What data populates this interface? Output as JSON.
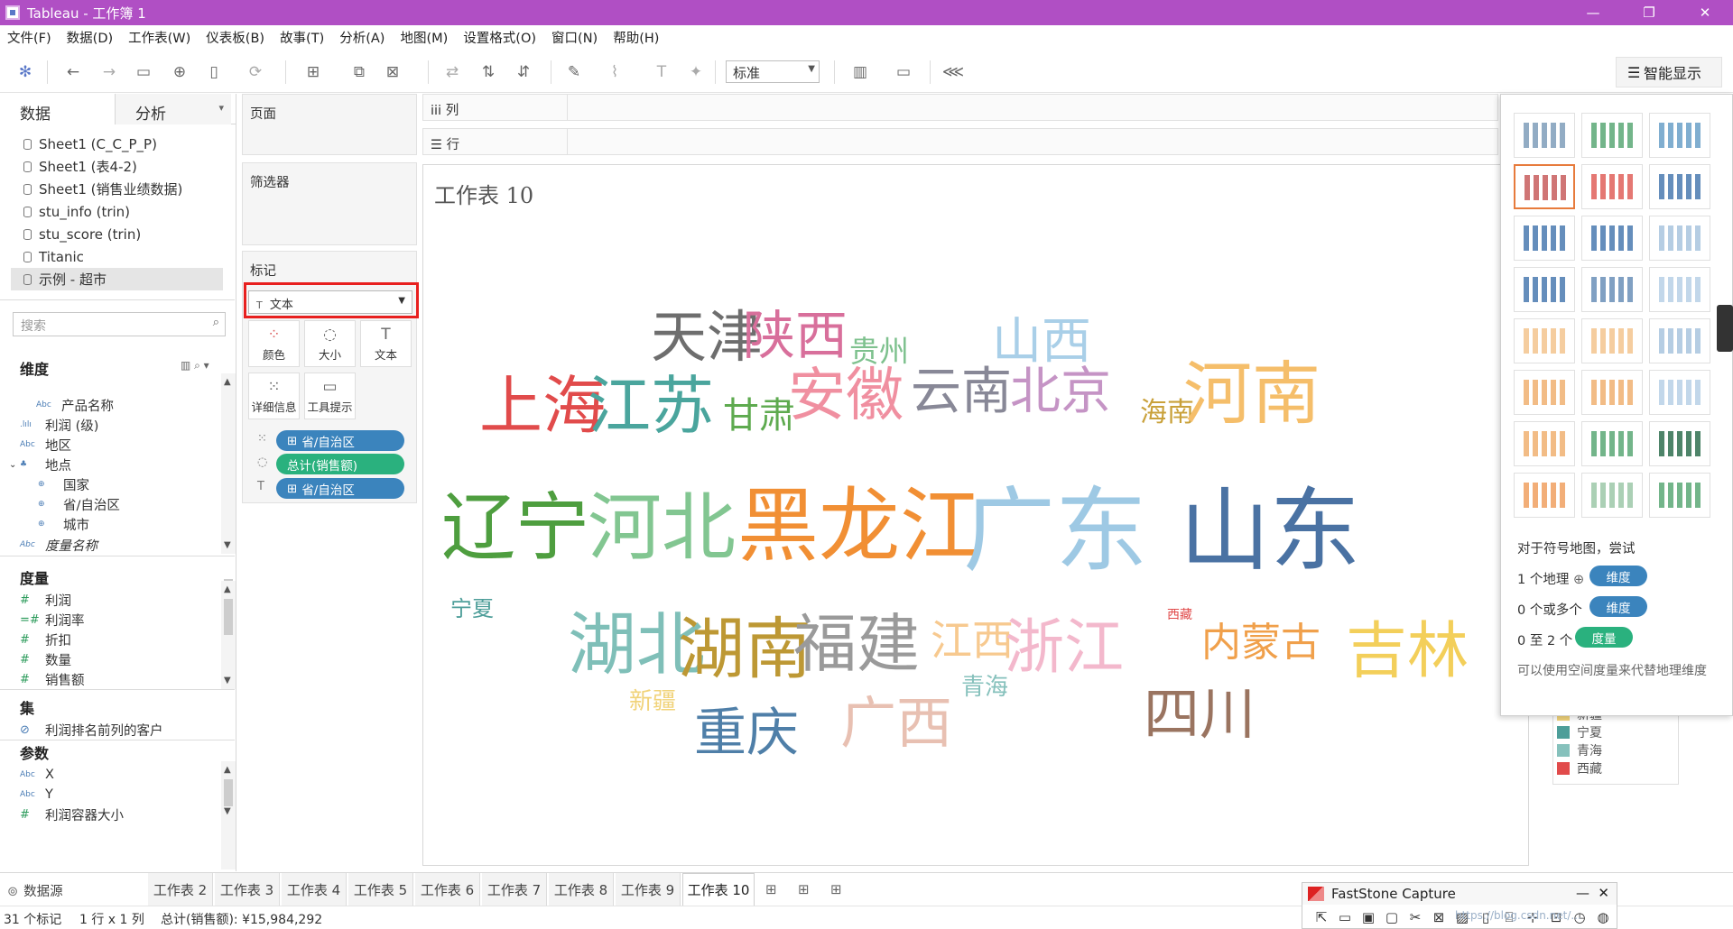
{
  "window": {
    "title": "Tableau - 工作簿 1",
    "controls": [
      "—",
      "❐",
      "✕"
    ]
  },
  "menu": [
    "文件(F)",
    "数据(D)",
    "工作表(W)",
    "仪表板(B)",
    "故事(T)",
    "分析(A)",
    "地图(M)",
    "设置格式(O)",
    "窗口(N)",
    "帮助(H)"
  ],
  "toolbar": {
    "fit_select": "标准",
    "show_me_label": "智能显示",
    "icons": [
      "tableau-logo-icon",
      "undo-icon",
      "redo-icon",
      "save-icon",
      "new-datasource-icon",
      "pause-updates-icon",
      "refresh-icon",
      "new-worksheet-icon",
      "duplicate-icon",
      "clear-sheet-icon",
      "swap-icon",
      "sort-asc-icon",
      "sort-desc-icon",
      "highlight-icon",
      "group-icon",
      "label-icon",
      "fix-axes-icon",
      "show-cards-icon",
      "presentation-icon",
      "share-icon"
    ]
  },
  "left_pane": {
    "tabs": [
      "数据",
      "分析"
    ],
    "datasources": [
      "Sheet1 (C_C_P_P)",
      "Sheet1 (表4-2)",
      "Sheet1 (销售业绩数据)",
      "stu_info (trin)",
      "stu_score (trin)",
      "Titanic",
      "示例 - 超市"
    ],
    "search_placeholder": "搜索",
    "dimensions_title": "维度",
    "dimensions": [
      {
        "type": "Abc",
        "name": "产品名称"
      },
      {
        "type": ".lılı",
        "name": "利润 (级)"
      },
      {
        "type": "Abc",
        "name": "地区"
      },
      {
        "type": "♣",
        "name": "地点"
      },
      {
        "type": "⊕",
        "name": "国家"
      },
      {
        "type": "⊕",
        "name": "省/自治区"
      },
      {
        "type": "⊕",
        "name": "城市"
      },
      {
        "type": "Abc",
        "name": "度量名称"
      }
    ],
    "measures_title": "度量",
    "measures": [
      "利润",
      "利润率",
      "折扣",
      "数量",
      "销售额"
    ],
    "sets_title": "集",
    "sets": [
      "利润排名前列的客户"
    ],
    "params_title": "参数",
    "params": [
      {
        "type": "Abc",
        "name": "X"
      },
      {
        "type": "Abc",
        "name": "Y"
      },
      {
        "type": "#",
        "name": "利润容器大小"
      }
    ]
  },
  "shelves": {
    "pages": "页面",
    "filters": "筛选器",
    "marks": "标记",
    "columns": "iii 列",
    "rows": "☰ 行"
  },
  "marks_card": {
    "mark_type": "文本",
    "buttons": [
      "颜色",
      "大小",
      "文本",
      "详细信息",
      "工具提示"
    ],
    "pills": [
      "省/自治区",
      "总计(销售额)",
      "省/自治区"
    ]
  },
  "view": {
    "sheet_title": "工作表 10",
    "words": [
      {
        "text": "天津",
        "color": "#6e6e6e"
      },
      {
        "text": "陕西",
        "color": "#d86f9b"
      },
      {
        "text": "贵州",
        "color": "#7ec18e"
      },
      {
        "text": "山西",
        "color": "#a9cfe8"
      },
      {
        "text": "上海",
        "color": "#e14b4b"
      },
      {
        "text": "江苏",
        "color": "#4aa59d"
      },
      {
        "text": "甘肃",
        "color": "#5eaa4f"
      },
      {
        "text": "安徽",
        "color": "#f08fa0"
      },
      {
        "text": "云南",
        "color": "#888897"
      },
      {
        "text": "北京",
        "color": "#c594c5"
      },
      {
        "text": "海南",
        "color": "#c9a13a"
      },
      {
        "text": "河南",
        "color": "#f5be6a"
      },
      {
        "text": "辽宁",
        "color": "#4e9e3f"
      },
      {
        "text": "河北",
        "color": "#82c691"
      },
      {
        "text": "黑龙江",
        "color": "#f18f34"
      },
      {
        "text": "广东",
        "color": "#9ec9e4"
      },
      {
        "text": "山东",
        "color": "#4a72a3"
      },
      {
        "text": "宁夏",
        "color": "#4d9e99"
      },
      {
        "text": "西藏",
        "color": "#e14b4b"
      },
      {
        "text": "湖北",
        "color": "#7fbfb8"
      },
      {
        "text": "湖南",
        "color": "#bd9834"
      },
      {
        "text": "福建",
        "color": "#9a9a9a"
      },
      {
        "text": "江西",
        "color": "#f7c98f"
      },
      {
        "text": "浙江",
        "color": "#f3b8cc"
      },
      {
        "text": "内蒙古",
        "color": "#f0a04b"
      },
      {
        "text": "吉林",
        "color": "#f3cf5a"
      },
      {
        "text": "青海",
        "color": "#86c1bc"
      },
      {
        "text": "新疆",
        "color": "#f1d37a"
      },
      {
        "text": "重庆",
        "color": "#4f7fa8"
      },
      {
        "text": "广西",
        "color": "#e8c0b2"
      },
      {
        "text": "四川",
        "color": "#9a7460"
      }
    ]
  },
  "legend": [
    {
      "text": "新疆",
      "color": "#f1d37a"
    },
    {
      "text": "宁夏",
      "color": "#4d9e99"
    },
    {
      "text": "青海",
      "color": "#86c1bc"
    },
    {
      "text": "西藏",
      "color": "#e14b4b"
    }
  ],
  "show_me": {
    "tip_heading": "对于符号地图，尝试",
    "tips": [
      {
        "prefix": "1 个地理",
        "icon": "⊕",
        "pill": "维度",
        "pill_color": "#3b84bd"
      },
      {
        "prefix": "0 个或多个",
        "icon": "",
        "pill": "维度",
        "pill_color": "#3b84bd"
      },
      {
        "prefix": "0 至 2 个",
        "icon": "",
        "pill": "度量",
        "pill_color": "#2ab17e"
      }
    ],
    "footer": "可以使用空间度量来代替地理维度",
    "chart_types": [
      "text-table",
      "heat-map",
      "highlight-table",
      "symbol-map",
      "filled-map",
      "pie-chart",
      "horizontal-bars",
      "stacked-bars",
      "side-by-side-bars",
      "treemap",
      "circle-view",
      "side-by-side-circles",
      "line-continuous",
      "line-discrete",
      "dual-line",
      "area-continuous",
      "area-discrete",
      "dual-combination",
      "scatter-plot",
      "histogram",
      "box-and-whisker",
      "gantt-chart",
      "bullet-graph",
      "packed-bubbles"
    ]
  },
  "sheet_tabs": {
    "datasource": "数据源",
    "tabs": [
      "工作表 2",
      "工作表 3",
      "工作表 4",
      "工作表 5",
      "工作表 6",
      "工作表 7",
      "工作表 8",
      "工作表 9",
      "工作表 10"
    ],
    "active": "工作表 10"
  },
  "status": {
    "marks": "31 个标记",
    "rows_cols": "1 行 x 1 列",
    "sum": "总计(销售额): ¥15,984,292"
  },
  "faststone": {
    "title": "FastStone Capture"
  },
  "watermark": "https://blog.csdn.net/..."
}
